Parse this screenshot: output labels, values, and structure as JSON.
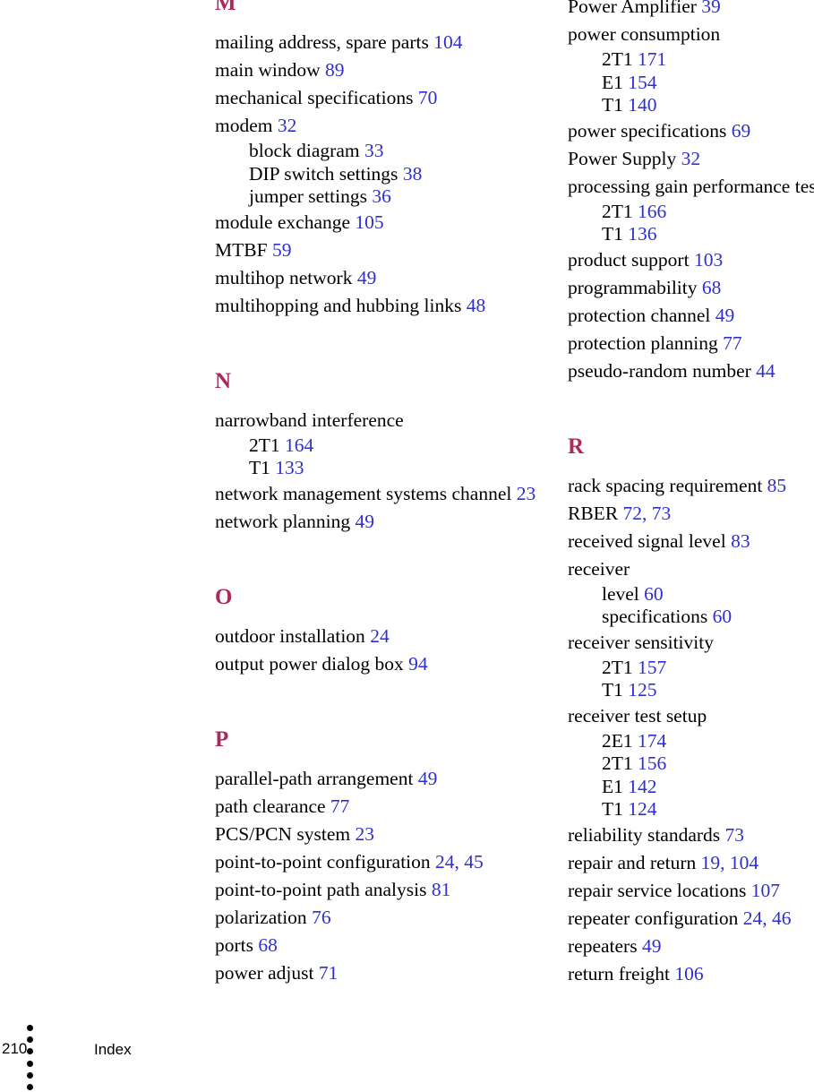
{
  "document": {
    "type": "book-index-page",
    "footer": {
      "page_number": "210",
      "label": "Index",
      "bullet_count": 6
    },
    "colors": {
      "page_number_blue": "#2f2fd0",
      "section_letter_crimson": "#ab2a5c",
      "body_text": "#000000",
      "background": "#ffffff"
    }
  },
  "columns": {
    "left": [
      {
        "kind": "letter",
        "text": "M"
      },
      {
        "kind": "entry",
        "term": "mailing address, spare parts",
        "pages": "104"
      },
      {
        "kind": "entry",
        "term": "main window",
        "pages": "89"
      },
      {
        "kind": "entry",
        "term": "mechanical specifications",
        "pages": "70"
      },
      {
        "kind": "entry",
        "term": "modem",
        "pages": "32"
      },
      {
        "kind": "sub",
        "term": "block diagram",
        "pages": "33"
      },
      {
        "kind": "sub",
        "term": "DIP switch settings",
        "pages": "38"
      },
      {
        "kind": "sub",
        "term": "jumper settings",
        "pages": "36"
      },
      {
        "kind": "entry",
        "term": "module exchange",
        "pages": "105"
      },
      {
        "kind": "entry",
        "term": "MTBF",
        "pages": "59"
      },
      {
        "kind": "entry",
        "term": "multihop network",
        "pages": "49"
      },
      {
        "kind": "entry",
        "term": "multihopping and hubbing links",
        "pages": "48"
      },
      {
        "kind": "letter",
        "text": "N"
      },
      {
        "kind": "entry",
        "term": "narrowband interference",
        "pages": ""
      },
      {
        "kind": "sub",
        "term": "2T1",
        "pages": "164"
      },
      {
        "kind": "sub",
        "term": "T1",
        "pages": "133"
      },
      {
        "kind": "entry",
        "term": "network management systems channel",
        "pages": "23"
      },
      {
        "kind": "entry",
        "term": "network planning",
        "pages": "49"
      },
      {
        "kind": "letter",
        "text": "O"
      },
      {
        "kind": "entry",
        "term": "outdoor installation",
        "pages": "24"
      },
      {
        "kind": "entry",
        "term": "output power dialog box",
        "pages": "94"
      },
      {
        "kind": "letter",
        "text": "P"
      },
      {
        "kind": "entry",
        "term": "parallel-path arrangement",
        "pages": "49"
      },
      {
        "kind": "entry",
        "term": "path clearance",
        "pages": "77"
      },
      {
        "kind": "entry",
        "term": "PCS/PCN system",
        "pages": "23"
      },
      {
        "kind": "entry",
        "term": "point-to-point configuration",
        "pages": "24, 45"
      },
      {
        "kind": "entry",
        "term": "point-to-point path analysis",
        "pages": "81"
      },
      {
        "kind": "entry",
        "term": "polarization",
        "pages": "76"
      },
      {
        "kind": "entry",
        "term": "ports",
        "pages": "68"
      },
      {
        "kind": "entry",
        "term": "power adjust",
        "pages": "71"
      }
    ],
    "right": [
      {
        "kind": "entry",
        "term": "Power Amplifier",
        "pages": "39"
      },
      {
        "kind": "entry",
        "term": "power consumption",
        "pages": ""
      },
      {
        "kind": "sub",
        "term": "2T1",
        "pages": "171"
      },
      {
        "kind": "sub",
        "term": "E1",
        "pages": "154"
      },
      {
        "kind": "sub",
        "term": "T1",
        "pages": "140"
      },
      {
        "kind": "entry",
        "term": "power specifications",
        "pages": "69"
      },
      {
        "kind": "entry",
        "term": "Power Supply",
        "pages": "32"
      },
      {
        "kind": "entry",
        "term": "processing gain performance test",
        "pages": ""
      },
      {
        "kind": "sub",
        "term": "2T1",
        "pages": "166"
      },
      {
        "kind": "sub",
        "term": "T1",
        "pages": "136"
      },
      {
        "kind": "entry",
        "term": "product support",
        "pages": "103"
      },
      {
        "kind": "entry",
        "term": "programmability",
        "pages": "68"
      },
      {
        "kind": "entry",
        "term": "protection channel",
        "pages": "49"
      },
      {
        "kind": "entry",
        "term": "protection planning",
        "pages": "77"
      },
      {
        "kind": "entry",
        "term": "pseudo-random number",
        "pages": "44"
      },
      {
        "kind": "letter",
        "text": "R"
      },
      {
        "kind": "entry",
        "term": "rack spacing requirement",
        "pages": "85"
      },
      {
        "kind": "entry",
        "term": "RBER",
        "pages": "72, 73"
      },
      {
        "kind": "entry",
        "term": "received signal level",
        "pages": "83"
      },
      {
        "kind": "entry",
        "term": "receiver",
        "pages": ""
      },
      {
        "kind": "sub",
        "term": "level",
        "pages": "60"
      },
      {
        "kind": "sub",
        "term": "specifications",
        "pages": "60"
      },
      {
        "kind": "entry",
        "term": "receiver sensitivity",
        "pages": ""
      },
      {
        "kind": "sub",
        "term": "2T1",
        "pages": "157"
      },
      {
        "kind": "sub",
        "term": "T1",
        "pages": "125"
      },
      {
        "kind": "entry",
        "term": "receiver test setup",
        "pages": ""
      },
      {
        "kind": "sub",
        "term": "2E1",
        "pages": "174"
      },
      {
        "kind": "sub",
        "term": "2T1",
        "pages": "156"
      },
      {
        "kind": "sub",
        "term": "E1",
        "pages": "142"
      },
      {
        "kind": "sub",
        "term": "T1",
        "pages": "124"
      },
      {
        "kind": "entry",
        "term": "reliability standards",
        "pages": "73"
      },
      {
        "kind": "entry",
        "term": "repair and return",
        "pages": "19, 104"
      },
      {
        "kind": "entry",
        "term": "repair service locations",
        "pages": "107"
      },
      {
        "kind": "entry",
        "term": "repeater configuration",
        "pages": "24, 46"
      },
      {
        "kind": "entry",
        "term": "repeaters",
        "pages": "49"
      },
      {
        "kind": "entry",
        "term": "return freight",
        "pages": "106"
      }
    ]
  }
}
